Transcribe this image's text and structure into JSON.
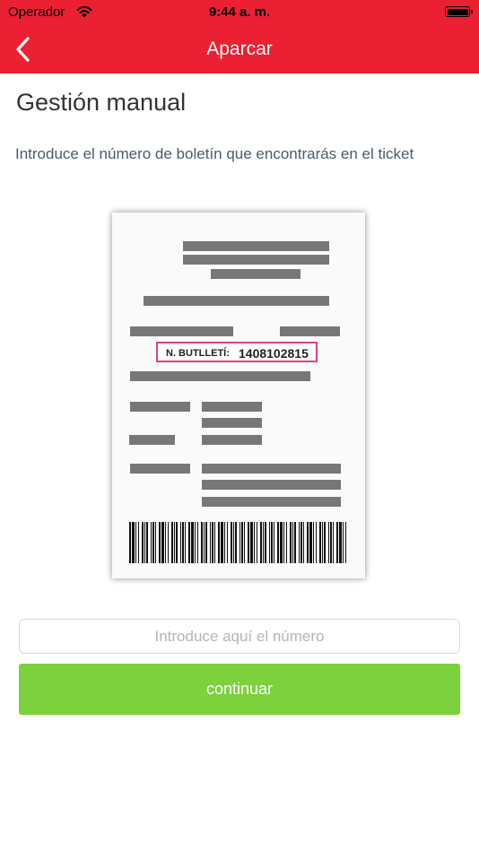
{
  "status_bar": {
    "carrier": "Operador",
    "time": "9:44 a. m.",
    "wifi_icon": "wifi-icon",
    "battery_icon": "battery-icon"
  },
  "nav": {
    "title": "Aparcar",
    "back_icon": "chevron-left-icon",
    "background_color": "#ec2033"
  },
  "content": {
    "heading": "Gestión manual",
    "instructions": "Introduce el número de boletín que encontrarás en el ticket"
  },
  "ticket_image": {
    "label": "N. BUTLLETÍ:",
    "number": "1408102815"
  },
  "form": {
    "input_placeholder": "Introduce aquí el número",
    "input_value": "",
    "continue_label": "continuar",
    "continue_color": "#7dd13d"
  }
}
